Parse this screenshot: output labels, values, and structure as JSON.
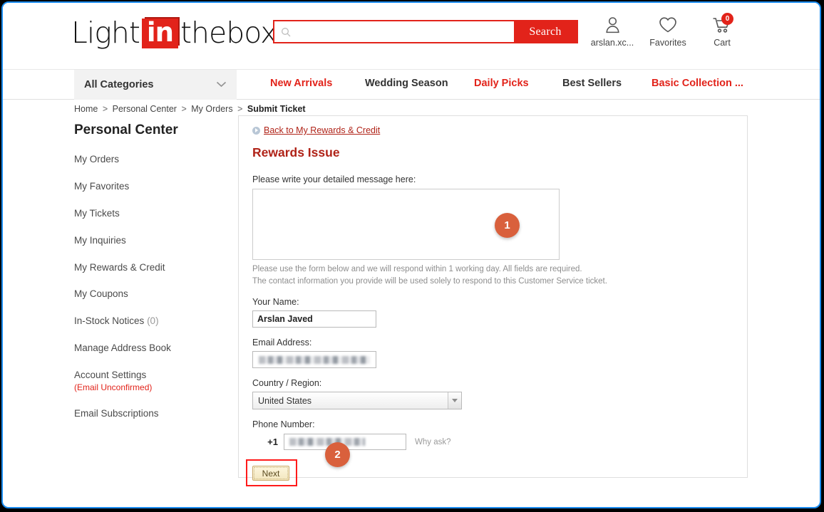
{
  "header": {
    "logo": {
      "part1": "Light",
      "highlight": "in",
      "part2": "thebox"
    },
    "search": {
      "value": "",
      "placeholder": "",
      "button_label": "Search"
    },
    "account": {
      "label": "arslan.xc...",
      "icon": "user-icon"
    },
    "favorites": {
      "label": "Favorites",
      "icon": "heart-icon"
    },
    "cart": {
      "label": "Cart",
      "icon": "cart-icon",
      "count": "0"
    }
  },
  "nav": {
    "all_categories": "All Categories",
    "links": [
      {
        "label": "New Arrivals",
        "color": "#e2231a"
      },
      {
        "label": "Wedding Season",
        "color": "#333333"
      },
      {
        "label": "Daily Picks",
        "color": "#e2231a"
      },
      {
        "label": "Best Sellers",
        "color": "#333333"
      },
      {
        "label": "Basic Collection ...",
        "color": "#e2231a"
      }
    ]
  },
  "breadcrumb": {
    "items": [
      "Home",
      "Personal Center",
      "My Orders"
    ],
    "current": "Submit Ticket",
    "separator": ">"
  },
  "sidebar": {
    "title": "Personal Center",
    "items": [
      {
        "label": "My Orders"
      },
      {
        "label": "My Favorites"
      },
      {
        "label": "My Tickets"
      },
      {
        "label": "My Inquiries"
      },
      {
        "label": "My Rewards & Credit"
      },
      {
        "label": "My Coupons"
      },
      {
        "label": "In-Stock Notices",
        "count": "(0)"
      },
      {
        "label": "Manage Address Book"
      },
      {
        "label": "Account Settings",
        "sub": "(Email Unconfirmed)"
      },
      {
        "label": "Email Subscriptions"
      }
    ]
  },
  "main": {
    "back_link": "Back to My Rewards & Credit",
    "title": "Rewards Issue",
    "message_label": "Please write your detailed message here:",
    "message_value": "",
    "note_line1": "Please use the form below and we will respond within 1 working day. All fields are required.",
    "note_line2": "The contact information you provide will be used solely to respond to this Customer Service ticket.",
    "name_label": "Your Name:",
    "name_value": "Arslan Javed",
    "email_label": "Email Address:",
    "email_value": "",
    "country_label": "Country / Region:",
    "country_value": "United States",
    "phone_label": "Phone Number:",
    "phone_country_code": "+1",
    "phone_value": "",
    "why_ask": "Why ask?",
    "next_label": "Next"
  },
  "annotations": [
    {
      "number": "1",
      "color": "#d9603c"
    },
    {
      "number": "2",
      "color": "#d9603c"
    }
  ]
}
